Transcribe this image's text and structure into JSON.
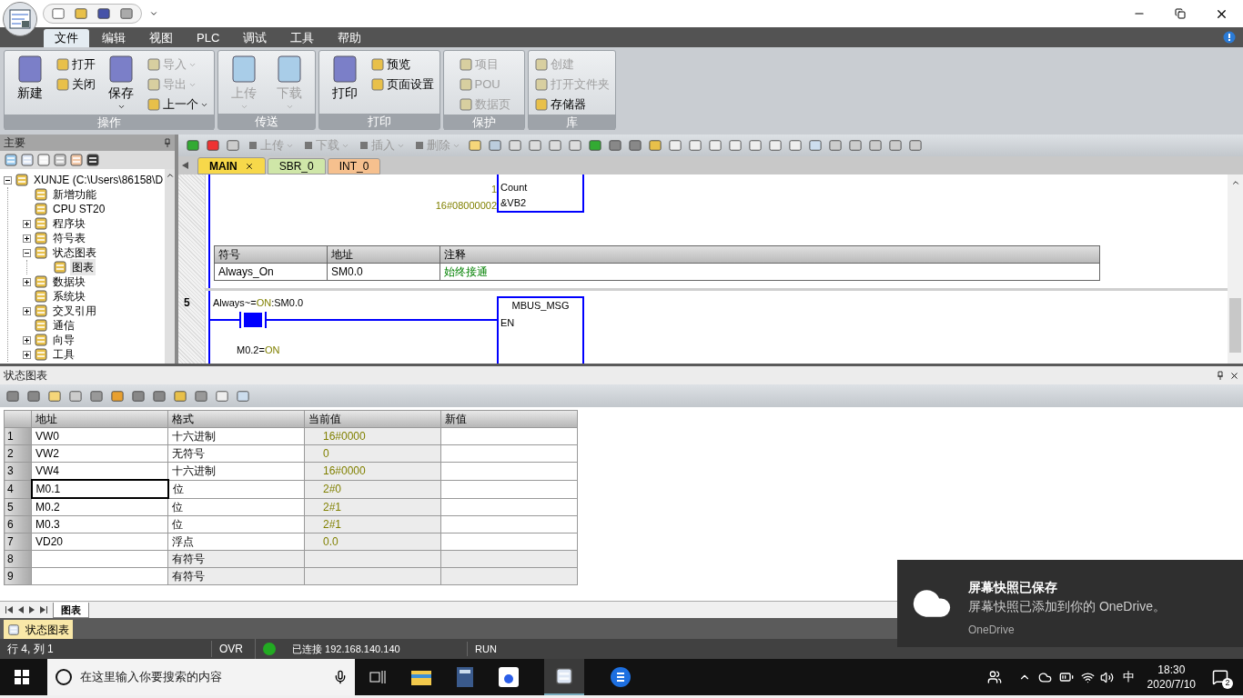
{
  "menu_tabs": [
    {
      "label": "文件",
      "selected": true
    },
    {
      "label": "编辑",
      "selected": false
    },
    {
      "label": "视图",
      "selected": false
    },
    {
      "label": "PLC",
      "selected": false
    },
    {
      "label": "调试",
      "selected": false
    },
    {
      "label": "工具",
      "selected": false
    },
    {
      "label": "帮助",
      "selected": false
    }
  ],
  "ribbon_groups": [
    {
      "title": "操作",
      "items": [
        {
          "label": "新建",
          "kind": "large",
          "disabled": false,
          "dropdown": false
        },
        {
          "label": "打开",
          "kind": "small",
          "disabled": false,
          "dropdown": false
        },
        {
          "label": "关闭",
          "kind": "small",
          "disabled": false,
          "dropdown": false
        },
        {
          "label": "保存",
          "kind": "large",
          "disabled": false,
          "dropdown": true
        },
        {
          "label": "导入",
          "kind": "small",
          "disabled": true,
          "dropdown": true
        },
        {
          "label": "导出",
          "kind": "small",
          "disabled": true,
          "dropdown": true
        },
        {
          "label": "上一个",
          "kind": "small",
          "disabled": false,
          "dropdown": true
        }
      ]
    },
    {
      "title": "传送",
      "items": [
        {
          "label": "上传",
          "kind": "large",
          "disabled": true,
          "dropdown": true
        },
        {
          "label": "下载",
          "kind": "large",
          "disabled": true,
          "dropdown": true
        }
      ]
    },
    {
      "title": "打印",
      "items": [
        {
          "label": "打印",
          "kind": "large",
          "disabled": false,
          "dropdown": false
        },
        {
          "label": "预览",
          "kind": "small",
          "disabled": false,
          "dropdown": false
        },
        {
          "label": "页面设置",
          "kind": "small",
          "disabled": false,
          "dropdown": false
        }
      ]
    },
    {
      "title": "保护",
      "items": [
        {
          "label": "项目",
          "kind": "small",
          "disabled": true,
          "dropdown": false
        },
        {
          "label": "POU",
          "kind": "small",
          "disabled": true,
          "dropdown": false
        },
        {
          "label": "数据页",
          "kind": "small",
          "disabled": true,
          "dropdown": false
        }
      ]
    },
    {
      "title": "库",
      "items": [
        {
          "label": "创建",
          "kind": "small",
          "disabled": true,
          "dropdown": false
        },
        {
          "label": "打开文件夹",
          "kind": "small",
          "disabled": true,
          "dropdown": false
        },
        {
          "label": "存储器",
          "kind": "small",
          "disabled": false,
          "dropdown": false
        }
      ]
    }
  ],
  "left_panel": {
    "title": "主要",
    "tree": [
      {
        "label": "XUNJE (C:\\Users\\86158\\D",
        "selected": false,
        "expanded": true,
        "children": [
          {
            "label": "新增功能",
            "selected": false
          },
          {
            "label": "CPU ST20",
            "selected": false
          },
          {
            "label": "程序块",
            "selected": false,
            "expanded": false
          },
          {
            "label": "符号表",
            "selected": false,
            "expanded": false
          },
          {
            "label": "状态图表",
            "selected": false,
            "expanded": true,
            "children": [
              {
                "label": "图表",
                "selected": true
              }
            ]
          },
          {
            "label": "数据块",
            "selected": false,
            "expanded": false
          },
          {
            "label": "系统块",
            "selected": false
          },
          {
            "label": "交叉引用",
            "selected": false,
            "expanded": false
          },
          {
            "label": "通信",
            "selected": false
          },
          {
            "label": "向导",
            "selected": false,
            "expanded": false
          },
          {
            "label": "工具",
            "selected": false,
            "expanded": false
          }
        ]
      }
    ]
  },
  "editor_toolbar": [
    {
      "label": "上传",
      "disabled": true
    },
    {
      "label": "下载",
      "disabled": true
    },
    {
      "label": "插入",
      "disabled": true
    },
    {
      "label": "删除",
      "disabled": true
    }
  ],
  "editor_tabs": [
    {
      "label": "MAIN",
      "selected": true,
      "color": "#f7d84a"
    },
    {
      "label": "SBR_0",
      "selected": false,
      "color": "#cfe6a8"
    },
    {
      "label": "INT_0",
      "selected": false,
      "color": "#f6c08e"
    }
  ],
  "ladder": {
    "prev_inputs": [
      {
        "value": "1",
        "pin": "Count"
      },
      {
        "value": "16#08000002",
        "pin": "&VB2"
      }
    ],
    "symbol_table": {
      "columns": [
        "符号",
        "地址",
        "注释"
      ],
      "rows": [
        [
          "Always_On",
          "SM0.0",
          "始终接通"
        ]
      ]
    },
    "network": {
      "number": "5",
      "contact_name": "Always~=",
      "contact_state": "ON",
      "contact_address": ":SM0.0",
      "contact_on": true,
      "box_title": "MBUS_MSG",
      "box_pin": "EN",
      "second_name": "M0.2=",
      "second_state": "ON"
    }
  },
  "status_chart": {
    "title": "状态图表",
    "columns": [
      "地址",
      "格式",
      "当前值",
      "新值"
    ],
    "rows": [
      {
        "num": "1",
        "address": "VW0",
        "format": "十六进制",
        "current": "16#0000",
        "selected": false,
        "empty": false
      },
      {
        "num": "2",
        "address": "VW2",
        "format": "无符号",
        "current": "0",
        "selected": false,
        "empty": false
      },
      {
        "num": "3",
        "address": "VW4",
        "format": "十六进制",
        "current": "16#0000",
        "selected": false,
        "empty": false
      },
      {
        "num": "4",
        "address": "M0.1",
        "format": "位",
        "current": "2#0",
        "selected": true,
        "empty": false
      },
      {
        "num": "5",
        "address": "M0.2",
        "format": "位",
        "current": "2#1",
        "selected": false,
        "empty": false
      },
      {
        "num": "6",
        "address": "M0.3",
        "format": "位",
        "current": "2#1",
        "selected": false,
        "empty": false
      },
      {
        "num": "7",
        "address": "VD20",
        "format": "浮点",
        "current": "0.0",
        "selected": false,
        "empty": false
      },
      {
        "num": "8",
        "format": "有符号",
        "selected": false,
        "empty": true
      },
      {
        "num": "9",
        "format": "有符号",
        "selected": false,
        "empty": true
      }
    ],
    "sheet_tab": "图表"
  },
  "doc_tab": "状态图表",
  "status_bar": {
    "position": "行 4, 列 1",
    "mode": "OVR",
    "online": true,
    "connection": "已连接 192.168.140.140",
    "run_state": "RUN"
  },
  "taskbar": {
    "search_placeholder": "在这里输入你要搜索的内容",
    "ime": "中",
    "time": "18:30",
    "date": "2020/7/10",
    "notifications": "2"
  },
  "toast": {
    "title": "屏幕快照已保存",
    "body": "屏幕快照已添加到你的 OneDrive。",
    "source": "OneDrive"
  }
}
